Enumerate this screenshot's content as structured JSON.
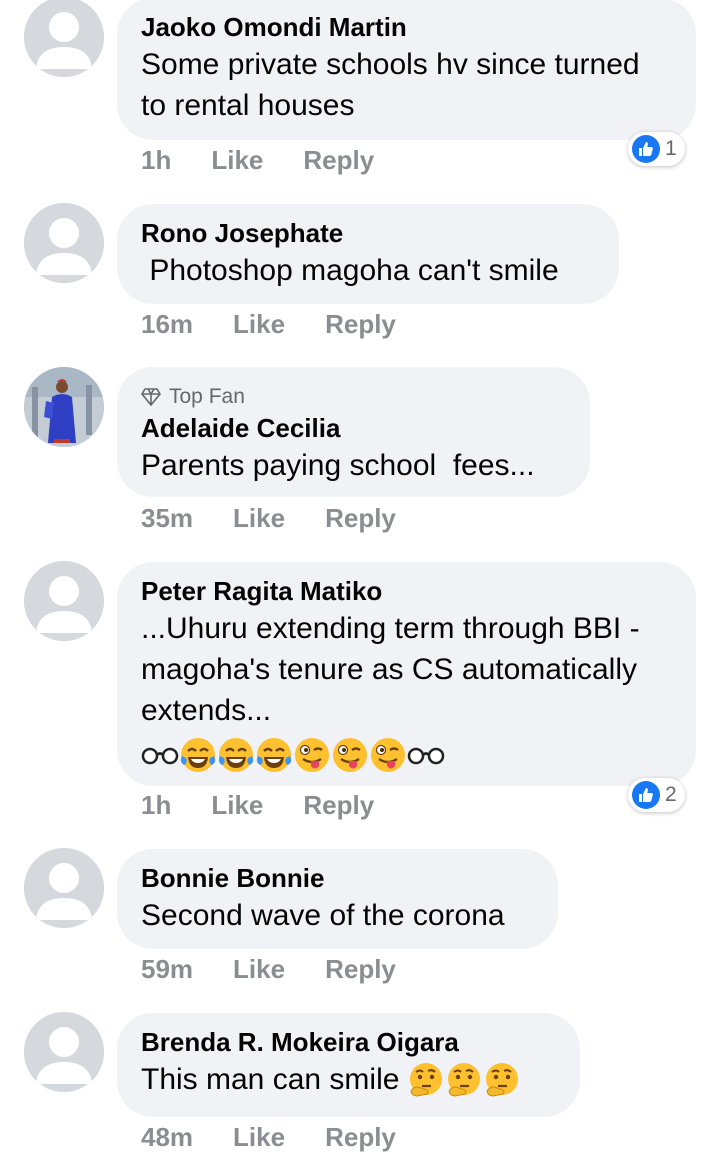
{
  "comments": [
    {
      "name": "Jaoko Omondi Martin",
      "text": "Some private schools hv since turned to rental houses",
      "time": "1h",
      "like": "Like",
      "reply": "Reply",
      "reaction_count": "1"
    },
    {
      "name": "Rono Josephate",
      "text": " Photoshop magoha can't smile",
      "time": "16m",
      "like": "Like",
      "reply": "Reply"
    },
    {
      "badge": "Top Fan",
      "name": "Adelaide Cecilia",
      "text": "Parents paying school  fees...",
      "time": "35m",
      "like": "Like",
      "reply": "Reply"
    },
    {
      "name": "Peter Ragita Matiko",
      "text": "...Uhuru extending term through BBI -magoha's tenure as CS automatically extends...",
      "time": "1h",
      "like": "Like",
      "reply": "Reply",
      "reaction_count": "2"
    },
    {
      "name": "Bonnie Bonnie",
      "text": "Second wave of the corona",
      "time": "59m",
      "like": "Like",
      "reply": "Reply"
    },
    {
      "name": "Brenda R. Mokeira Oigara",
      "text": "This man can smile",
      "time": "48m",
      "like": "Like",
      "reply": "Reply"
    }
  ],
  "colors": {
    "bubble": "#f0f2f5",
    "action_text": "#8a8d91",
    "like_blue": "#1877f2",
    "avatar_bg": "#d5d8dd"
  },
  "icons": [
    "default-avatar-icon",
    "like-reaction-icon",
    "diamond-icon",
    "glasses-emoji",
    "tears-of-joy-emoji",
    "winking-tongue-emoji",
    "thinking-emoji"
  ]
}
